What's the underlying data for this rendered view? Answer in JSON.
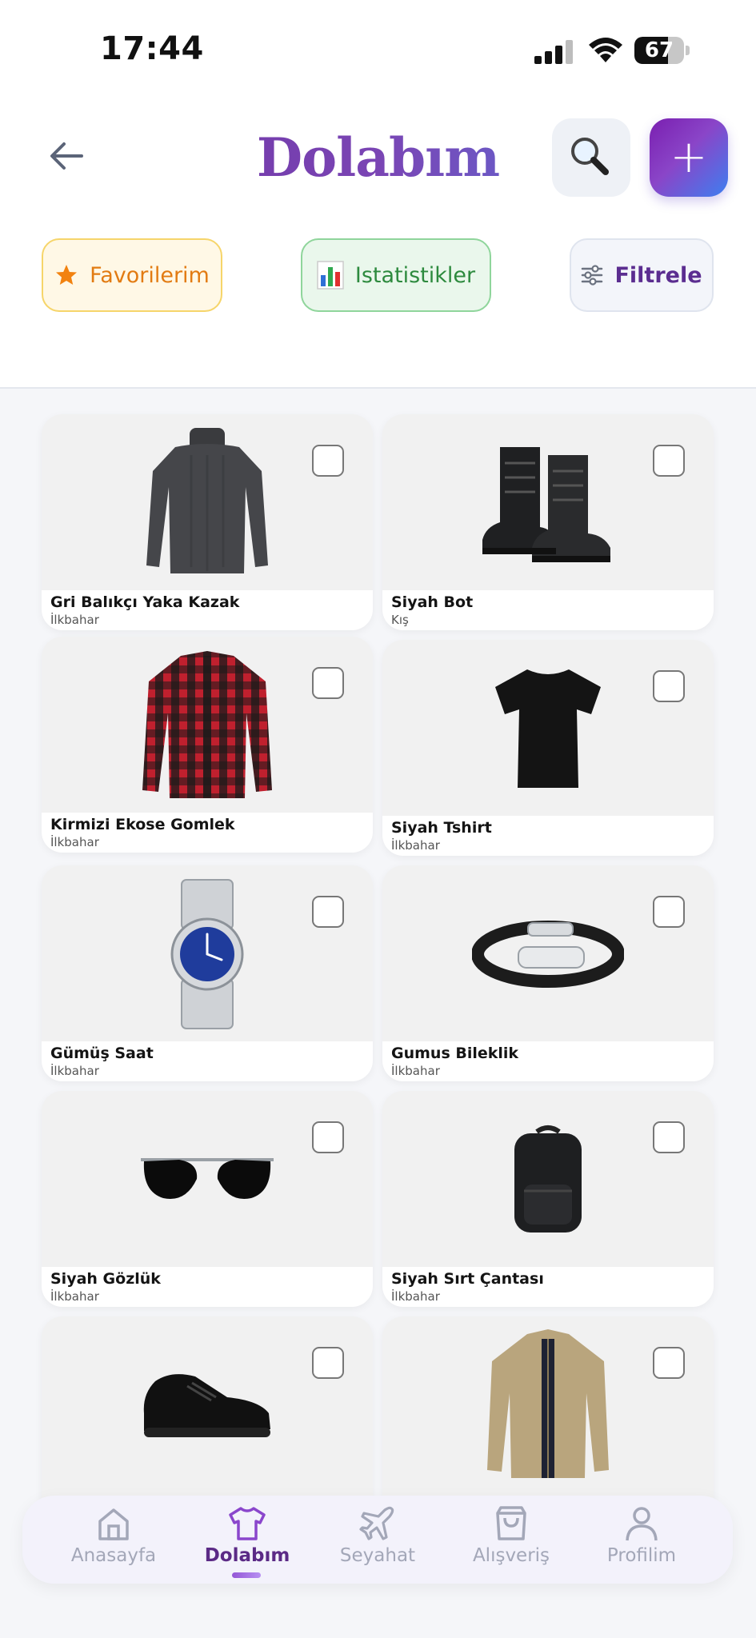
{
  "status_bar": {
    "time": "17:44",
    "battery": "67",
    "battery_level": 0.67
  },
  "header": {
    "title": "Dolabım"
  },
  "chips": {
    "favorites": "Favorilerim",
    "stats": "Istatistikler",
    "filter": "Filtrele"
  },
  "items": [
    {
      "name": "Gri Balıkçı Yaka Kazak",
      "season": "İlkbahar",
      "icon": "turtleneck-sweater-image"
    },
    {
      "name": "Siyah Bot",
      "season": "Kış",
      "icon": "black-boots-image"
    },
    {
      "name": "Kirmizi Ekose Gomlek",
      "season": "İlkbahar",
      "icon": "plaid-shirt-image"
    },
    {
      "name": "Siyah Tshirt",
      "season": "İlkbahar",
      "icon": "black-tshirt-image"
    },
    {
      "name": "Gümüş Saat",
      "season": "İlkbahar",
      "icon": "silver-watch-image"
    },
    {
      "name": "Gumus Bileklik",
      "season": "İlkbahar",
      "icon": "bracelet-image"
    },
    {
      "name": "Siyah Gözlük",
      "season": "İlkbahar",
      "icon": "sunglasses-image"
    },
    {
      "name": "Siyah Sırt Çantası",
      "season": "İlkbahar",
      "icon": "backpack-image"
    },
    {
      "name": "",
      "season": "",
      "icon": "black-sneaker-image"
    },
    {
      "name": "",
      "season": "",
      "icon": "khaki-jacket-image"
    }
  ],
  "nav": [
    {
      "label": "Anasayfa",
      "icon": "home-icon",
      "active": false
    },
    {
      "label": "Dolabım",
      "icon": "shirt-icon",
      "active": true
    },
    {
      "label": "Seyahat",
      "icon": "airplane-icon",
      "active": false
    },
    {
      "label": "Alışveriş",
      "icon": "shopping-bag-icon",
      "active": false
    },
    {
      "label": "Profilim",
      "icon": "profile-icon",
      "active": false
    }
  ],
  "colors": {
    "accent": "#5b2a86",
    "gradient_start": "#7a1fb0",
    "gradient_end": "#3d7ff0"
  }
}
